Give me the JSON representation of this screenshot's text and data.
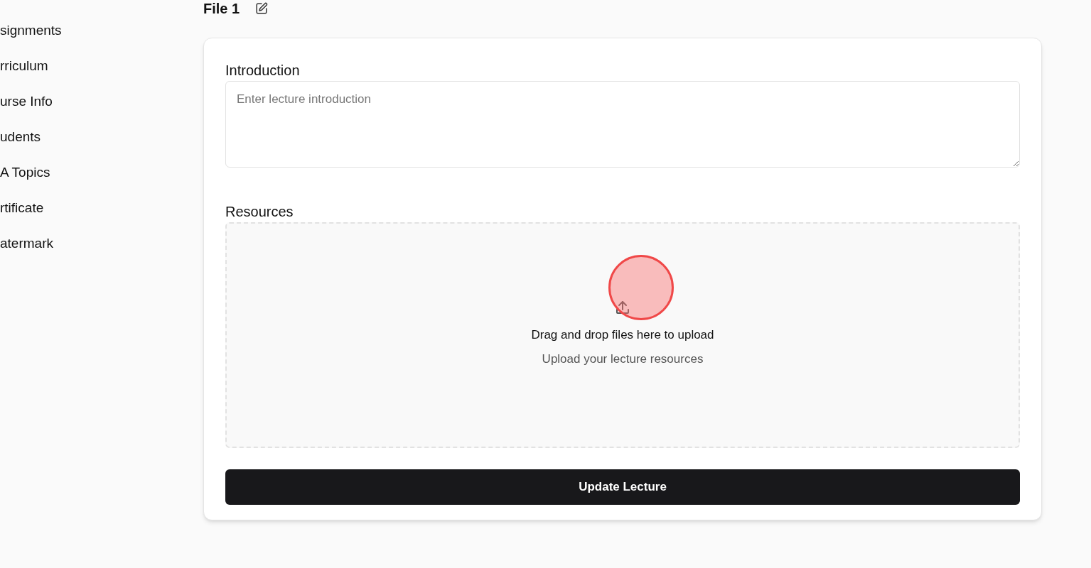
{
  "sidebar": {
    "items": [
      {
        "label": "signments"
      },
      {
        "label": "rriculum"
      },
      {
        "label": "urse Info"
      },
      {
        "label": "udents"
      },
      {
        "label": "A Topics"
      },
      {
        "label": "rtificate"
      },
      {
        "label": "atermark"
      }
    ]
  },
  "title": "File 1",
  "form": {
    "introduction": {
      "label": "Introduction",
      "placeholder": "Enter lecture introduction"
    },
    "resources": {
      "label": "Resources",
      "prompt": "Drag and drop files here to upload",
      "hint": "Upload your lecture resources"
    },
    "submit": "Update Lecture"
  }
}
